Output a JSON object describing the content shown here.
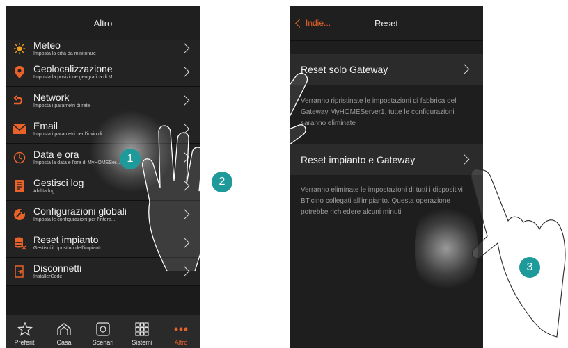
{
  "left": {
    "title": "Altro",
    "items": [
      {
        "label": "Meteo",
        "sub": "Imposta la città da minitorare",
        "icon": "sun-icon"
      },
      {
        "label": "Geolocalizzazione",
        "sub": "Imposta la posizione geografica di M...",
        "icon": "location-pin-icon"
      },
      {
        "label": "Network",
        "sub": "Imposta i parametri di rete",
        "icon": "network-icon"
      },
      {
        "label": "Email",
        "sub": "Imposta i parametri per l'invio di...",
        "icon": "envelope-icon"
      },
      {
        "label": "Data e ora",
        "sub": "Imposta la data e l'ora di MyHOMESer...",
        "icon": "clock-icon"
      },
      {
        "label": "Gestisci log",
        "sub": "Abilita log",
        "icon": "log-icon"
      },
      {
        "label": "Configurazioni globali",
        "sub": "Imposta le configurazioni per l'intera...",
        "icon": "config-icon"
      },
      {
        "label": "Reset impianto",
        "sub": "Gestisci il ripristino dell'impianto",
        "icon": "database-reset-icon"
      },
      {
        "label": "Disconnetti",
        "sub": "InstallerCode",
        "icon": "logout-icon"
      }
    ],
    "tabs": [
      {
        "label": "Preferiti",
        "icon": "star-icon"
      },
      {
        "label": "Casa",
        "icon": "house-icon"
      },
      {
        "label": "Scenari",
        "icon": "scenes-icon"
      },
      {
        "label": "Sistemi",
        "icon": "grid-icon"
      },
      {
        "label": "Altro",
        "icon": "more-dots-icon"
      }
    ]
  },
  "right": {
    "back_label": "Indie...",
    "title": "Reset",
    "option1": "Reset solo Gateway",
    "desc1": "Verranno ripristinate le impostazioni di fabbrica del Gateway MyHOMEServer1, tutte le configurazioni saranno eliminate",
    "option2": "Reset impianto e Gateway",
    "desc2": "Verranno eliminate le impostazioni di tutti i dispositivi BTicino collegati all'impianto. Questa operazione potrebbe richiedere alcuni minuti"
  },
  "steps": [
    "1",
    "2",
    "3"
  ],
  "colors": {
    "accent": "#e8622a",
    "badge": "#1f9a9a",
    "background": "#1b1b1b"
  }
}
